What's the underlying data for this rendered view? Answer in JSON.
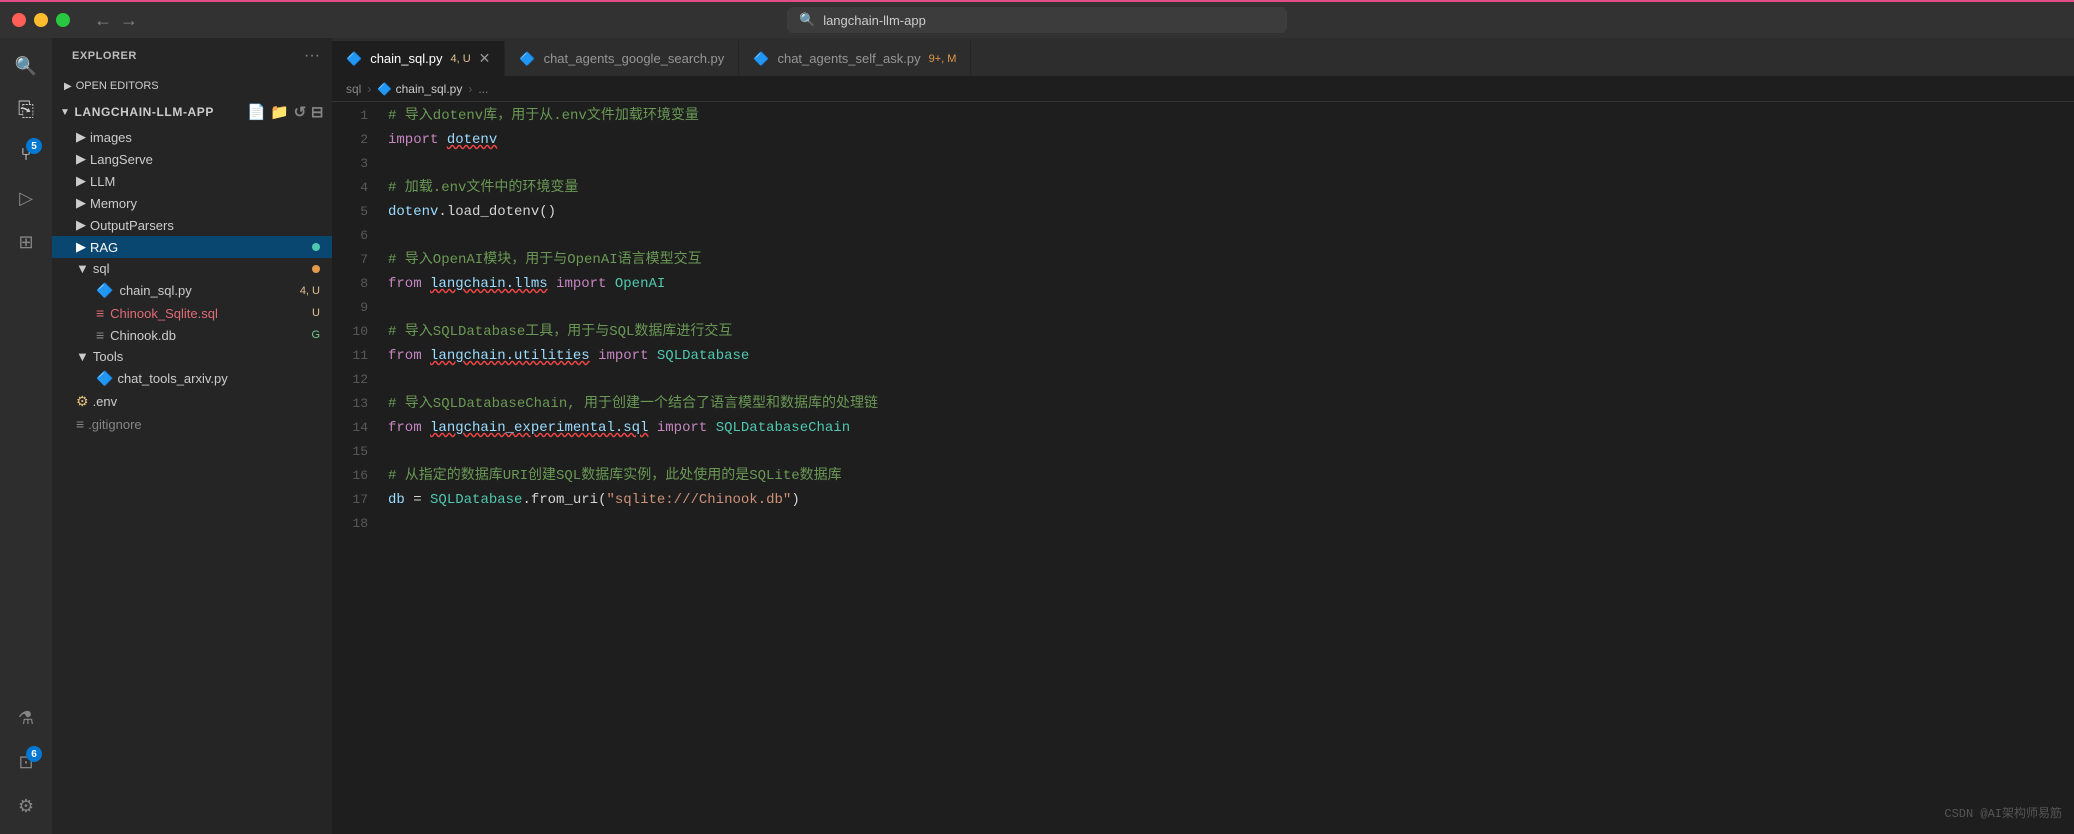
{
  "titlebar": {
    "search_placeholder": "langchain-llm-app",
    "nav_back": "←",
    "nav_forward": "→"
  },
  "activity_bar": {
    "items": [
      {
        "name": "search",
        "icon": "🔍",
        "active": false
      },
      {
        "name": "explorer",
        "icon": "⎘",
        "active": false
      },
      {
        "name": "source-control",
        "icon": "⑂",
        "badge": "5",
        "active": true
      },
      {
        "name": "run",
        "icon": "▷",
        "active": false
      },
      {
        "name": "extensions",
        "icon": "⊞",
        "active": false
      },
      {
        "name": "remote",
        "icon": "⊡",
        "badge": "6",
        "active": false
      }
    ],
    "bottom_items": [
      {
        "name": "beaker",
        "icon": "⚗"
      },
      {
        "name": "account",
        "icon": "⚙"
      }
    ]
  },
  "sidebar": {
    "header": "EXPLORER",
    "header_actions": [
      "···"
    ],
    "open_editors_label": "OPEN EDITORS",
    "project_name": "LANGCHAIN-LLM-APP",
    "tree_items": [
      {
        "label": "images",
        "type": "folder",
        "indent": 1
      },
      {
        "label": "LangServe",
        "type": "folder",
        "indent": 1
      },
      {
        "label": "LLM",
        "type": "folder",
        "indent": 1
      },
      {
        "label": "Memory",
        "type": "folder",
        "indent": 1
      },
      {
        "label": "OutputParsers",
        "type": "folder",
        "indent": 1
      },
      {
        "label": "RAG",
        "type": "folder",
        "indent": 1,
        "active": true,
        "badge_type": "dot-teal"
      },
      {
        "label": "sql",
        "type": "folder-open",
        "indent": 1,
        "badge_type": "dot-orange"
      },
      {
        "label": "chain_sql.py",
        "type": "python",
        "indent": 2,
        "badge": "4, U",
        "badge_color": "yellow"
      },
      {
        "label": "Chinook_Sqlite.sql",
        "type": "sql",
        "indent": 2,
        "badge": "U",
        "badge_color": "yellow"
      },
      {
        "label": "Chinook.db",
        "type": "db",
        "indent": 2,
        "badge": "G",
        "badge_color": "green"
      },
      {
        "label": "Tools",
        "type": "folder-open",
        "indent": 1
      },
      {
        "label": "chat_tools_arxiv.py",
        "type": "python",
        "indent": 2
      },
      {
        "label": ".env",
        "type": "env",
        "indent": 1
      },
      {
        "label": ".gitignore",
        "type": "git",
        "indent": 1
      }
    ]
  },
  "tabs": [
    {
      "label": "chain_sql.py",
      "badge": "4, U",
      "active": true,
      "type": "python",
      "modified": false
    },
    {
      "label": "chat_agents_google_search.py",
      "active": false,
      "type": "python"
    },
    {
      "label": "chat_agents_self_ask.py",
      "badge": "9+, M",
      "active": false,
      "type": "python"
    }
  ],
  "breadcrumb": {
    "parts": [
      "sql",
      "chain_sql.py",
      "..."
    ]
  },
  "code": {
    "lines": [
      {
        "num": 1,
        "content": [
          {
            "text": "    # 导入dotenv库，用于从.env文件加载环境变量",
            "class": "c-comment"
          }
        ]
      },
      {
        "num": 2,
        "content": [
          {
            "text": "    ",
            "class": "c-text"
          },
          {
            "text": "import",
            "class": "c-keyword"
          },
          {
            "text": " ",
            "class": "c-text"
          },
          {
            "text": "dotenv",
            "class": "c-module",
            "squiggle": true
          }
        ]
      },
      {
        "num": 3,
        "content": []
      },
      {
        "num": 4,
        "content": [
          {
            "text": "    # 加载.env文件中的环境变量",
            "class": "c-comment"
          }
        ]
      },
      {
        "num": 5,
        "content": [
          {
            "text": "    ",
            "class": "c-text"
          },
          {
            "text": "dotenv",
            "class": "c-var"
          },
          {
            "text": ".load_dotenv()",
            "class": "c-text"
          }
        ]
      },
      {
        "num": 6,
        "content": []
      },
      {
        "num": 7,
        "content": [
          {
            "text": "    # 导入OpenAI模块，用于与OpenAI语言模型交互",
            "class": "c-comment"
          }
        ]
      },
      {
        "num": 8,
        "content": [
          {
            "text": "    ",
            "class": "c-text"
          },
          {
            "text": "from",
            "class": "c-keyword"
          },
          {
            "text": " ",
            "class": "c-text"
          },
          {
            "text": "langchain.llms",
            "class": "c-module",
            "squiggle": true
          },
          {
            "text": " ",
            "class": "c-text"
          },
          {
            "text": "import",
            "class": "c-keyword"
          },
          {
            "text": " ",
            "class": "c-text"
          },
          {
            "text": "OpenAI",
            "class": "c-builtin"
          }
        ]
      },
      {
        "num": 9,
        "content": []
      },
      {
        "num": 10,
        "content": [
          {
            "text": "    # 导入SQLDatabase工具，用于与SQL数据库进行交互",
            "class": "c-comment"
          }
        ]
      },
      {
        "num": 11,
        "content": [
          {
            "text": "    ",
            "class": "c-text"
          },
          {
            "text": "from",
            "class": "c-keyword"
          },
          {
            "text": " ",
            "class": "c-text"
          },
          {
            "text": "langchain.utilities",
            "class": "c-module",
            "squiggle": true
          },
          {
            "text": " ",
            "class": "c-text"
          },
          {
            "text": "import",
            "class": "c-keyword"
          },
          {
            "text": " ",
            "class": "c-text"
          },
          {
            "text": "SQLDatabase",
            "class": "c-builtin"
          }
        ]
      },
      {
        "num": 12,
        "content": []
      },
      {
        "num": 13,
        "content": [
          {
            "text": "    # 导入SQLDatabaseChain, 用于创建一个结合了语言模型和数据库的处理链",
            "class": "c-comment"
          }
        ]
      },
      {
        "num": 14,
        "content": [
          {
            "text": "    ",
            "class": "c-text"
          },
          {
            "text": "from",
            "class": "c-keyword"
          },
          {
            "text": " ",
            "class": "c-text"
          },
          {
            "text": "langchain_experimental.sql",
            "class": "c-module",
            "squiggle": true
          },
          {
            "text": " ",
            "class": "c-text"
          },
          {
            "text": "import",
            "class": "c-keyword"
          },
          {
            "text": " ",
            "class": "c-text"
          },
          {
            "text": "SQLDatabaseChain",
            "class": "c-builtin"
          }
        ]
      },
      {
        "num": 15,
        "content": []
      },
      {
        "num": 16,
        "content": [
          {
            "text": "    # 从指定的数据库URI创建SQL数据库实例，此处使用的是SQLite数据库",
            "class": "c-comment"
          }
        ]
      },
      {
        "num": 17,
        "content": [
          {
            "text": "    ",
            "class": "c-text"
          },
          {
            "text": "db",
            "class": "c-var"
          },
          {
            "text": " = ",
            "class": "c-text"
          },
          {
            "text": "SQLDatabase",
            "class": "c-builtin"
          },
          {
            "text": ".from_uri(",
            "class": "c-text"
          },
          {
            "text": "\"sqlite:///Chinook.db\"",
            "class": "c-string"
          },
          {
            "text": ")",
            "class": "c-text"
          }
        ]
      },
      {
        "num": 18,
        "content": []
      }
    ]
  },
  "watermark": "CSDN @AI架构师易筋"
}
